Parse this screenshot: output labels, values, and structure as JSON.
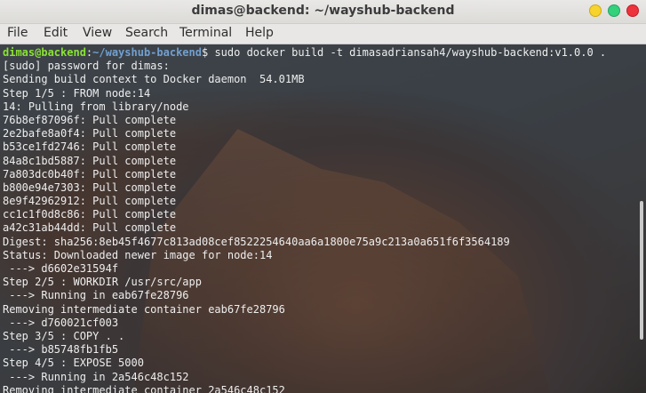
{
  "window": {
    "title": "dimas@backend: ~/wayshub-backend"
  },
  "menubar": {
    "items": [
      "File",
      "Edit",
      "View",
      "Search",
      "Terminal",
      "Help"
    ]
  },
  "prompt": {
    "user_host": "dimas@backend",
    "separator": ":",
    "path": "~/wayshub-backend",
    "symbol": "$",
    "command": " sudo docker build -t dimasadriansah4/wayshub-backend:v1.0.0 ."
  },
  "output_lines": [
    "[sudo] password for dimas:",
    "Sending build context to Docker daemon  54.01MB",
    "Step 1/5 : FROM node:14",
    "14: Pulling from library/node",
    "76b8ef87096f: Pull complete",
    "2e2bafe8a0f4: Pull complete",
    "b53ce1fd2746: Pull complete",
    "84a8c1bd5887: Pull complete",
    "7a803dc0b40f: Pull complete",
    "b800e94e7303: Pull complete",
    "8e9f42962912: Pull complete",
    "cc1c1f0d8c86: Pull complete",
    "a42c31ab44dd: Pull complete",
    "Digest: sha256:8eb45f4677c813ad08cef8522254640aa6a1800e75a9c213a0a651f6f3564189",
    "Status: Downloaded newer image for node:14",
    " ---> d6602e31594f",
    "Step 2/5 : WORKDIR /usr/src/app",
    " ---> Running in eab67fe28796",
    "Removing intermediate container eab67fe28796",
    " ---> d760021cf003",
    "Step 3/5 : COPY . .",
    " ---> b85748fb1fb5",
    "Step 4/5 : EXPOSE 5000",
    " ---> Running in 2a546c48c152",
    "Removing intermediate container 2a546c48c152"
  ],
  "colors": {
    "prompt_user": "#8ae234",
    "prompt_path": "#729fcf",
    "text": "#eeeeee"
  }
}
